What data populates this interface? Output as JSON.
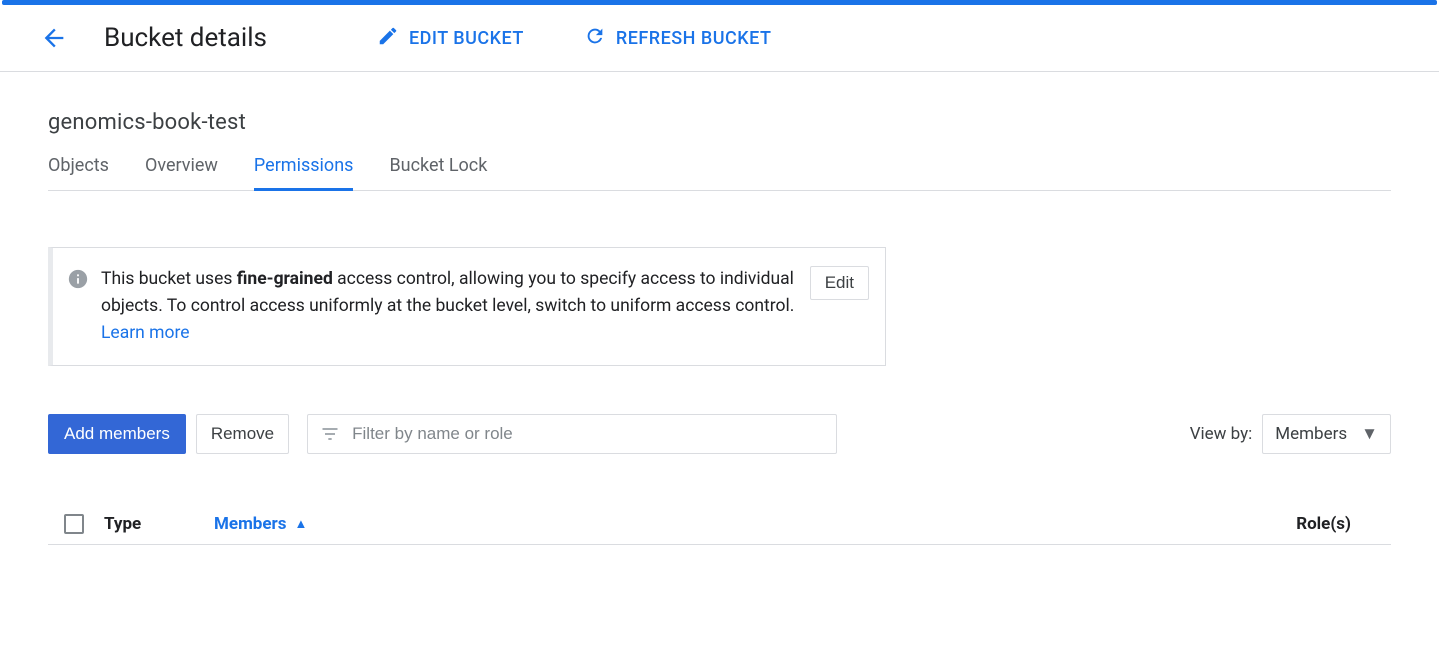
{
  "header": {
    "title": "Bucket details",
    "edit_label": "EDIT BUCKET",
    "refresh_label": "REFRESH BUCKET"
  },
  "bucket_name": "genomics-book-test",
  "tabs": {
    "objects": "Objects",
    "overview": "Overview",
    "permissions": "Permissions",
    "bucket_lock": "Bucket Lock"
  },
  "info": {
    "prefix": "This bucket uses ",
    "bold": "fine-grained",
    "suffix": " access control, allowing you to specify access to individual objects. To control access uniformly at the bucket level, switch to uniform access control. ",
    "learn_more": "Learn more",
    "edit_label": "Edit"
  },
  "toolbar": {
    "add_label": "Add members",
    "remove_label": "Remove",
    "filter_placeholder": "Filter by name or role",
    "viewby_label": "View by:",
    "viewby_selected": "Members"
  },
  "table": {
    "th_type": "Type",
    "th_members": "Members",
    "th_roles": "Role(s)"
  }
}
